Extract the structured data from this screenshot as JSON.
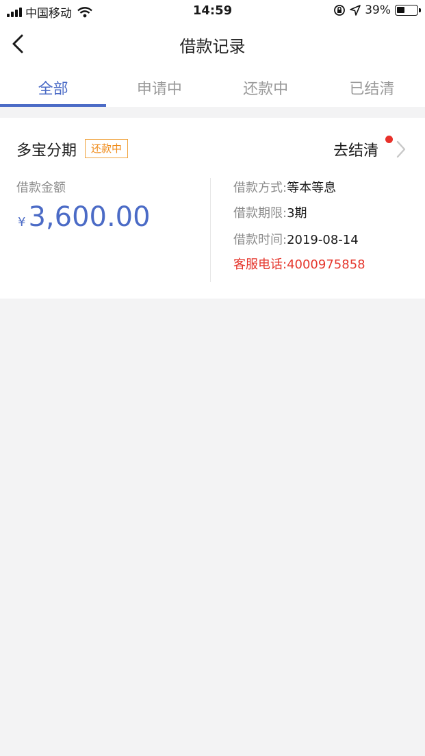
{
  "status_bar": {
    "carrier": "中国移动",
    "time": "14:59",
    "battery_percent": "39%",
    "battery_level": 0.39,
    "icons": [
      "signal-icon",
      "wifi-icon",
      "orientation-lock-icon",
      "location-icon",
      "battery-icon"
    ]
  },
  "nav": {
    "title": "借款记录",
    "back_icon": "back-chevron-icon"
  },
  "tabs": [
    {
      "label": "全部",
      "active": true
    },
    {
      "label": "申请中",
      "active": false
    },
    {
      "label": "还款中",
      "active": false
    },
    {
      "label": "已结清",
      "active": false
    }
  ],
  "loan": {
    "product_name": "多宝分期",
    "status_badge": "还款中",
    "action_label": "去结清",
    "amount_label": "借款金额",
    "currency": "¥",
    "amount": "3,600.00",
    "details": [
      {
        "key": "借款方式:",
        "value": "等本等息"
      },
      {
        "key": "借款期限:",
        "value": "3期"
      },
      {
        "key": "借款时间:",
        "value": "2019-08-14"
      },
      {
        "key": "客服电话:",
        "value": "4000975858"
      }
    ]
  },
  "colors": {
    "accent": "#4b6bc6",
    "badge": "#ef8a18",
    "alert": "#e5352b",
    "background": "#f3f3f4"
  }
}
